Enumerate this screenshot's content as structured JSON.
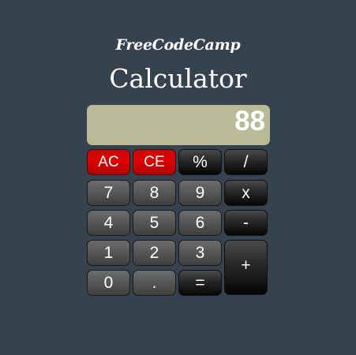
{
  "header": {
    "brand": "FreeCodeCamp",
    "title": "Calculator"
  },
  "display": {
    "value": "88",
    "background_color": "#b9ba98"
  },
  "keys": {
    "ac": "AC",
    "ce": "CE",
    "percent": "%",
    "divide": "/",
    "seven": "7",
    "eight": "8",
    "nine": "9",
    "multiply": "x",
    "four": "4",
    "five": "5",
    "six": "6",
    "subtract": "-",
    "one": "1",
    "two": "2",
    "three": "3",
    "add": "+",
    "zero": "0",
    "decimal": ".",
    "equals": "="
  },
  "colors": {
    "page_background": "#36434f",
    "clear_keys": "#d40000",
    "operator_keys": "#1a1a1a",
    "digit_keys": "#5a5a5a"
  }
}
